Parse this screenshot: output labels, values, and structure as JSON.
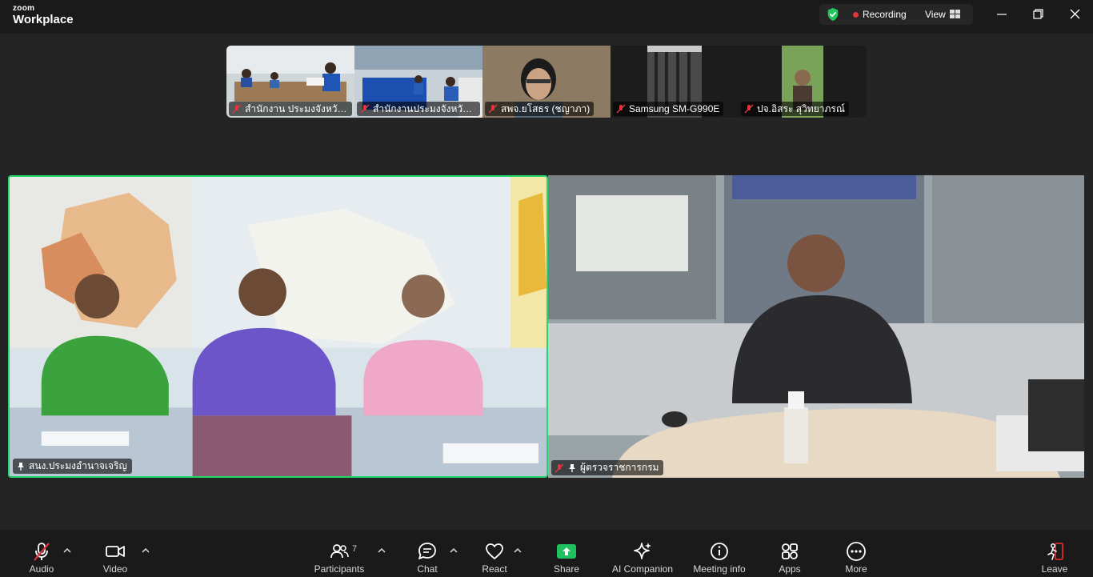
{
  "app": {
    "brand_small": "zoom",
    "brand_big": "Workplace"
  },
  "titlebar": {
    "recording_label": "Recording",
    "view_label": "View",
    "security_icon": "shield-check-icon",
    "colors": {
      "shield": "#22c55e",
      "recording_dot": "#e0363c"
    }
  },
  "thumbnails": [
    {
      "name": "สำนักงาน ประมงจังหวัดอุ...",
      "muted": true
    },
    {
      "name": "สำนักงานประมงจังหวัดยโส...",
      "muted": true
    },
    {
      "name": "สพจ.ยโสธร (ชญาภา)",
      "muted": true
    },
    {
      "name": "Samsung SM-G990E",
      "muted": true
    },
    {
      "name": "ปจ.อิสระ สุวิทยาภรณ์",
      "muted": true
    }
  ],
  "main_tiles": [
    {
      "name": "สนง.ประมงอำนาจเจริญ",
      "pinned": true,
      "muted": false,
      "active_speaker": true
    },
    {
      "name": "ผู้ตรวจราชการกรม",
      "pinned": true,
      "muted": true,
      "active_speaker": false
    }
  ],
  "toolbar": {
    "audio_label": "Audio",
    "video_label": "Video",
    "participants_label": "Participants",
    "participants_count": "7",
    "chat_label": "Chat",
    "react_label": "React",
    "share_label": "Share",
    "ai_label": "AI Companion",
    "info_label": "Meeting info",
    "apps_label": "Apps",
    "more_label": "More",
    "leave_label": "Leave",
    "colors": {
      "share": "#1fc25f",
      "leave": "#e02828",
      "muted": "#e0363c"
    }
  }
}
